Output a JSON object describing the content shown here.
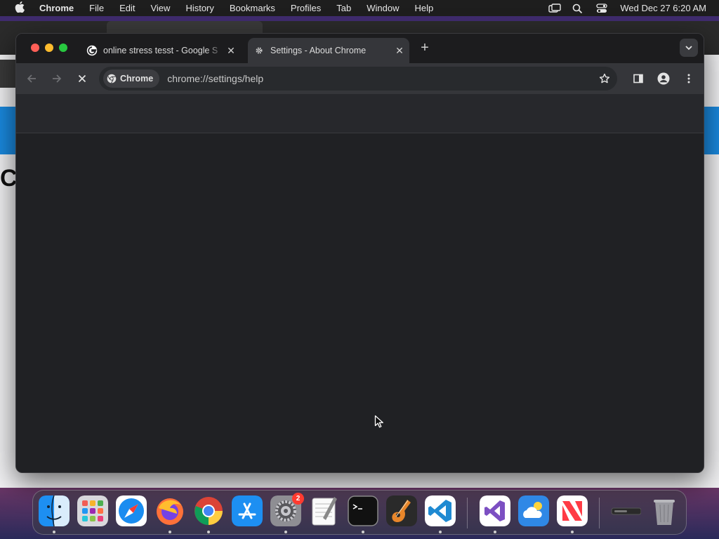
{
  "menubar": {
    "app_name": "Chrome",
    "items": [
      "File",
      "Edit",
      "View",
      "History",
      "Bookmarks",
      "Profiles",
      "Tab",
      "Window",
      "Help"
    ],
    "clock": "Wed Dec 27  6:20 AM",
    "icons": [
      "apple-icon",
      "screen-mirroring-icon",
      "spotlight-search-icon",
      "control-center-icon"
    ]
  },
  "browser": {
    "tabs": [
      {
        "title": "online stress tesst - Google S",
        "favicon": "google-icon",
        "active": false
      },
      {
        "title": "Settings - About Chrome",
        "favicon": "settings-gear-icon",
        "active": true
      }
    ],
    "omnibox": {
      "chip_label": "Chrome",
      "url": "chrome://settings/help"
    },
    "loading": true
  },
  "background_letter": "C",
  "dock": {
    "apps": [
      "Finder",
      "Launchpad",
      "Safari",
      "Firefox",
      "Google Chrome",
      "App Store",
      "System Settings",
      "TextEdit",
      "Terminal",
      "GarageBand",
      "Visual Studio Code",
      "Visual Studio",
      "Weather",
      "News",
      "Downloads",
      "Trash"
    ],
    "system_settings_badge": "2"
  }
}
